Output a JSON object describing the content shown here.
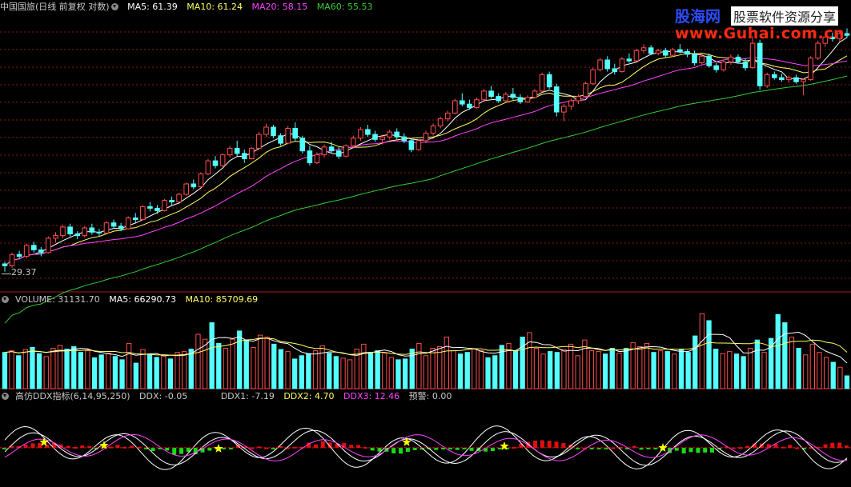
{
  "main_header": {
    "title": "中国国旅(日线 前复权 对数)",
    "ma5": "MA5: 61.39",
    "ma10": "MA10: 61.24",
    "ma20": "MA20: 58.15",
    "ma60": "MA60: 55.53"
  },
  "volume_header": {
    "volume": "VOLUME: 31131.70",
    "ma5": "MA5: 66290.73",
    "ma10": "MA10: 85709.69"
  },
  "indicator_header": {
    "name": "高仿DDX指标(6,14,95,250)",
    "ddx": "DDX: -0.05",
    "ddx1": "DDX1: -7.19",
    "ddx2": "DDX2: 4.70",
    "ddx3": "DDX3: 12.46",
    "alert": "预警: 0.00"
  },
  "price_low_label": "29.37",
  "watermark": {
    "line1_a": "股海网",
    "line1_b": "股票软件资源分享",
    "line2": "www.Guhai.com.cn"
  },
  "colors": {
    "background": "#000000",
    "up_candle": "#ff4d4d",
    "down_candle": "#54ffff",
    "ma5": "#ffffff",
    "ma10": "#ffff66",
    "ma20": "#ff44ff",
    "ma60": "#33cc33",
    "grid": "#8b1a1a",
    "divider": "#b01818",
    "ddx_pos": "#e01010",
    "ddx_neg": "#10e010",
    "star": "#ffff00"
  },
  "chart_data": [
    {
      "type": "candlestick",
      "title": "中国国旅(日线 前复权 对数)",
      "scale": "log",
      "lowest_marked_price": 29.37,
      "ylim": [
        28,
        70
      ],
      "candles": [
        [
          30.4,
          30.6,
          29.6,
          30.2
        ],
        [
          30.2,
          31.6,
          30.0,
          31.4
        ],
        [
          31.4,
          31.8,
          30.9,
          31.2
        ],
        [
          31.2,
          32.6,
          31.0,
          32.4
        ],
        [
          32.4,
          32.8,
          31.6,
          31.9
        ],
        [
          31.9,
          32.2,
          31.2,
          31.6
        ],
        [
          31.6,
          33.4,
          31.5,
          33.2
        ],
        [
          33.2,
          33.9,
          32.7,
          33.5
        ],
        [
          33.5,
          34.8,
          33.2,
          34.5
        ],
        [
          34.5,
          34.9,
          33.4,
          33.7
        ],
        [
          33.7,
          34.0,
          33.1,
          33.5
        ],
        [
          33.5,
          34.6,
          33.3,
          34.4
        ],
        [
          34.4,
          34.9,
          33.6,
          33.9
        ],
        [
          33.9,
          34.3,
          33.4,
          33.8
        ],
        [
          33.8,
          35.2,
          33.7,
          35.0
        ],
        [
          35.0,
          35.4,
          34.3,
          34.6
        ],
        [
          34.6,
          35.0,
          34.0,
          34.3
        ],
        [
          34.3,
          35.8,
          34.2,
          35.6
        ],
        [
          35.6,
          36.2,
          35.0,
          35.4
        ],
        [
          35.4,
          37.2,
          35.3,
          37.0
        ],
        [
          37.0,
          37.6,
          36.4,
          36.8
        ],
        [
          36.8,
          37.2,
          36.1,
          36.5
        ],
        [
          36.5,
          38.0,
          36.4,
          37.8
        ],
        [
          37.8,
          38.3,
          37.2,
          37.6
        ],
        [
          37.6,
          38.8,
          37.5,
          38.6
        ],
        [
          38.6,
          40.2,
          38.4,
          40.0
        ],
        [
          40.0,
          40.6,
          39.3,
          39.6
        ],
        [
          39.6,
          41.6,
          39.5,
          41.4
        ],
        [
          41.4,
          43.6,
          41.2,
          43.3
        ],
        [
          43.3,
          44.0,
          42.2,
          42.6
        ],
        [
          42.6,
          44.4,
          42.4,
          44.2
        ],
        [
          44.2,
          45.6,
          43.8,
          45.2
        ],
        [
          45.2,
          46.4,
          44.0,
          44.4
        ],
        [
          44.4,
          45.0,
          43.0,
          43.6
        ],
        [
          43.6,
          45.4,
          43.5,
          45.2
        ],
        [
          45.2,
          47.8,
          45.0,
          47.4
        ],
        [
          47.4,
          49.2,
          47.0,
          48.6
        ],
        [
          48.6,
          49.0,
          46.8,
          47.2
        ],
        [
          47.2,
          47.6,
          45.6,
          46.0
        ],
        [
          46.0,
          48.8,
          45.8,
          48.4
        ],
        [
          48.4,
          49.4,
          46.4,
          46.8
        ],
        [
          46.8,
          47.2,
          44.4,
          44.8
        ],
        [
          44.8,
          45.6,
          42.6,
          43.0
        ],
        [
          43.0,
          44.6,
          42.8,
          44.2
        ],
        [
          44.2,
          45.8,
          43.8,
          45.4
        ],
        [
          45.4,
          46.2,
          44.4,
          44.8
        ],
        [
          44.8,
          45.4,
          43.6,
          44.0
        ],
        [
          44.0,
          45.8,
          43.8,
          45.6
        ],
        [
          45.6,
          47.2,
          45.2,
          46.8
        ],
        [
          46.8,
          48.6,
          46.4,
          48.2
        ],
        [
          48.2,
          49.0,
          47.0,
          47.4
        ],
        [
          47.4,
          48.0,
          46.2,
          46.6
        ],
        [
          46.6,
          47.4,
          45.8,
          47.0
        ],
        [
          47.0,
          48.2,
          46.6,
          47.8
        ],
        [
          47.8,
          48.4,
          46.6,
          47.0
        ],
        [
          47.0,
          47.6,
          46.0,
          46.4
        ],
        [
          46.4,
          46.8,
          44.6,
          45.0
        ],
        [
          45.0,
          46.6,
          44.8,
          46.4
        ],
        [
          46.4,
          48.0,
          46.0,
          47.6
        ],
        [
          47.6,
          49.2,
          47.2,
          48.8
        ],
        [
          48.8,
          50.4,
          48.4,
          50.0
        ],
        [
          50.0,
          51.4,
          49.6,
          51.0
        ],
        [
          51.0,
          53.6,
          50.8,
          53.2
        ],
        [
          53.2,
          54.6,
          52.2,
          52.6
        ],
        [
          52.6,
          53.4,
          51.6,
          52.0
        ],
        [
          52.0,
          53.8,
          51.8,
          53.4
        ],
        [
          53.4,
          55.4,
          53.0,
          55.0
        ],
        [
          55.0,
          56.0,
          53.6,
          54.0
        ],
        [
          54.0,
          54.6,
          52.8,
          53.2
        ],
        [
          53.2,
          54.8,
          53.0,
          54.4
        ],
        [
          54.4,
          55.6,
          53.4,
          53.8
        ],
        [
          53.8,
          54.4,
          52.6,
          53.0
        ],
        [
          53.0,
          54.2,
          52.8,
          53.8
        ],
        [
          53.8,
          55.4,
          53.6,
          55.0
        ],
        [
          55.0,
          58.6,
          54.8,
          58.2
        ],
        [
          58.2,
          58.8,
          55.4,
          55.8
        ],
        [
          55.8,
          56.4,
          50.4,
          51.2
        ],
        [
          51.2,
          52.6,
          49.6,
          52.2
        ],
        [
          52.2,
          53.6,
          51.6,
          53.2
        ],
        [
          53.2,
          54.4,
          52.6,
          54.0
        ],
        [
          54.0,
          56.8,
          53.8,
          56.4
        ],
        [
          56.4,
          59.6,
          56.2,
          59.2
        ],
        [
          59.2,
          61.6,
          58.8,
          61.2
        ],
        [
          61.2,
          62.0,
          58.8,
          59.4
        ],
        [
          59.4,
          60.4,
          58.2,
          58.8
        ],
        [
          58.8,
          61.8,
          58.6,
          61.4
        ],
        [
          61.4,
          62.6,
          60.6,
          61.0
        ],
        [
          61.0,
          63.6,
          60.8,
          63.2
        ],
        [
          63.2,
          64.6,
          62.6,
          63.8
        ],
        [
          63.8,
          64.4,
          62.2,
          62.6
        ],
        [
          62.6,
          63.6,
          62.2,
          63.2
        ],
        [
          63.2,
          63.8,
          61.8,
          62.2
        ],
        [
          62.2,
          63.8,
          61.9,
          63.4
        ],
        [
          63.4,
          64.6,
          62.6,
          63.0
        ],
        [
          63.0,
          63.6,
          61.8,
          62.4
        ],
        [
          62.4,
          63.2,
          60.0,
          60.6
        ],
        [
          60.6,
          62.4,
          60.2,
          62.0
        ],
        [
          62.0,
          62.6,
          59.6,
          60.0
        ],
        [
          60.0,
          60.6,
          58.6,
          59.2
        ],
        [
          59.2,
          61.2,
          58.8,
          60.8
        ],
        [
          60.8,
          62.4,
          60.2,
          61.8
        ],
        [
          61.8,
          62.4,
          60.4,
          60.8
        ],
        [
          60.8,
          61.6,
          59.0,
          59.6
        ],
        [
          59.6,
          66.4,
          59.4,
          64.8
        ],
        [
          64.8,
          65.6,
          55.2,
          56.0
        ],
        [
          56.0,
          58.6,
          55.6,
          58.2
        ],
        [
          58.2,
          58.8,
          57.2,
          57.6
        ],
        [
          57.6,
          58.4,
          56.8,
          57.2
        ],
        [
          57.2,
          58.0,
          56.6,
          57.6
        ],
        [
          57.6,
          58.2,
          56.4,
          56.8
        ],
        [
          56.8,
          57.4,
          54.2,
          57.2
        ],
        [
          57.2,
          62.0,
          57.0,
          61.6
        ],
        [
          61.6,
          65.4,
          61.2,
          64.8
        ],
        [
          64.8,
          66.8,
          64.0,
          66.2
        ],
        [
          66.2,
          67.2,
          65.2,
          65.8
        ],
        [
          65.8,
          67.6,
          65.2,
          67.0
        ],
        [
          67.0,
          68.2,
          66.0,
          66.6
        ]
      ],
      "ma_series": [
        {
          "name": "MA5",
          "last": 61.39
        },
        {
          "name": "MA10",
          "last": 61.24
        },
        {
          "name": "MA20",
          "last": 58.15
        },
        {
          "name": "MA60",
          "last": 55.53
        }
      ]
    },
    {
      "type": "bar",
      "title": "VOLUME",
      "current": 31131.7,
      "ma5": 66290.73,
      "ma10": 85709.69,
      "ylim": [
        0,
        200000
      ],
      "values": [
        88000,
        92000,
        80000,
        95000,
        100000,
        85000,
        78000,
        98000,
        105000,
        96000,
        102000,
        88000,
        92000,
        75000,
        82000,
        86000,
        78000,
        70000,
        110000,
        62000,
        95000,
        84000,
        76000,
        80000,
        72000,
        88000,
        90000,
        96000,
        132000,
        120000,
        160000,
        110000,
        98000,
        120000,
        140000,
        118000,
        100000,
        130000,
        125000,
        108000,
        95000,
        90000,
        72000,
        80000,
        85000,
        92000,
        104000,
        86000,
        78000,
        74000,
        70000,
        96000,
        108000,
        88000,
        92000,
        86000,
        76000,
        70000,
        72000,
        96000,
        110000,
        80000,
        98000,
        102000,
        125000,
        92000,
        84000,
        88000,
        96000,
        92000,
        75000,
        80000,
        105000,
        110000,
        92000,
        125000,
        136000,
        98000,
        84000,
        90000,
        88000,
        95000,
        108000,
        80000,
        118000,
        92000,
        90000,
        84000,
        98000,
        86000,
        98000,
        112000,
        102000,
        110000,
        88000,
        92000,
        90000,
        84000,
        96000,
        88000,
        128000,
        182000,
        165000,
        96000,
        85000,
        90000,
        84000,
        78000,
        98000,
        118000,
        88000,
        122000,
        180000,
        160000,
        125000,
        98000,
        82000,
        108000,
        88000,
        76000,
        64000,
        52000,
        31131.7
      ]
    },
    {
      "type": "line",
      "title": "高仿DDX指标(6,14,95,250)",
      "ylim": [
        -12,
        14
      ],
      "series": [
        {
          "name": "DDX",
          "last": -0.05
        },
        {
          "name": "DDX1",
          "last": -7.19
        },
        {
          "name": "DDX2",
          "last": 4.7
        },
        {
          "name": "DDX3",
          "last": 12.46
        },
        {
          "name": "预警",
          "last": 0.0
        }
      ]
    }
  ]
}
